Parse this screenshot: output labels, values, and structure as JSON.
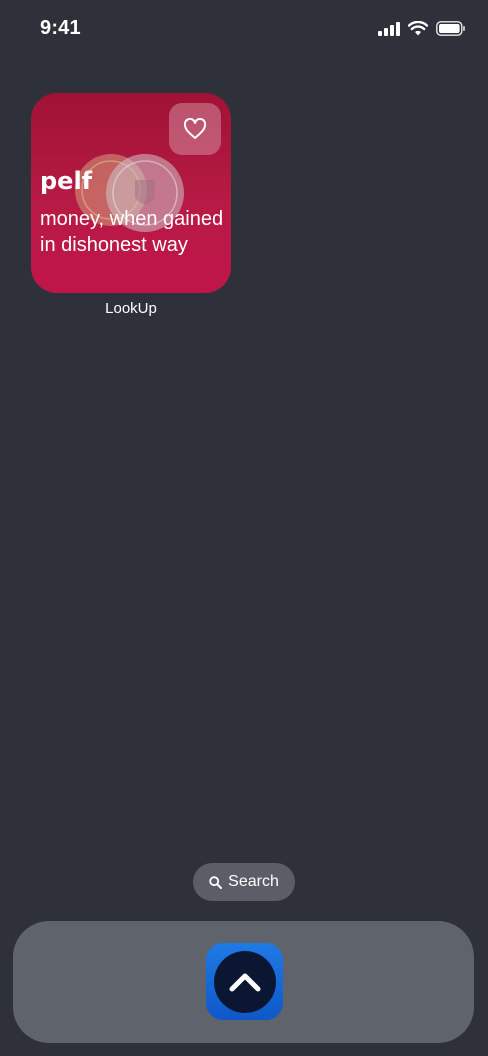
{
  "status_bar": {
    "time": "9:41",
    "icons": [
      "signal-icon",
      "wifi-icon",
      "battery-icon"
    ]
  },
  "widget": {
    "word": "pelf",
    "definition": "money, when gained in dishonest way",
    "label": "LookUp",
    "favorite_icon": "heart-icon",
    "background_color": "#b01a40"
  },
  "search": {
    "label": "Search",
    "icon": "search-icon"
  },
  "dock": {
    "apps": [
      {
        "icon": "chevron-up-icon",
        "color": "#1a6fe0"
      }
    ]
  }
}
